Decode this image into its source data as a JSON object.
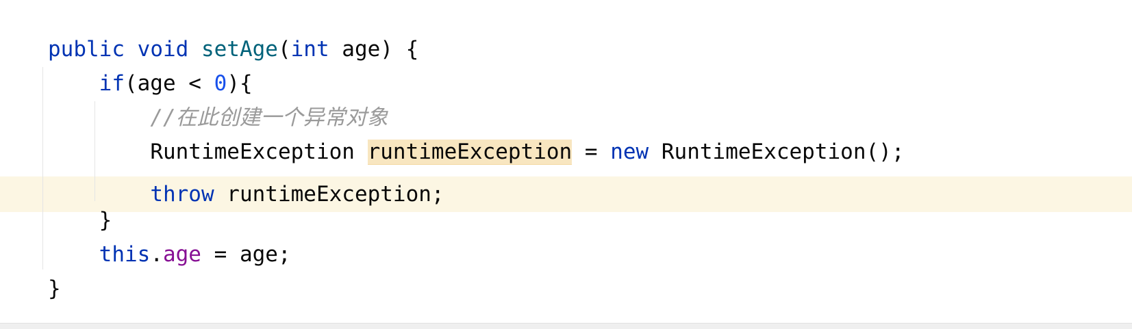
{
  "editor": {
    "lines": [
      {
        "indent": "",
        "tokens": [
          {
            "kind": "kw",
            "text": "public"
          },
          {
            "kind": "plain",
            "text": " "
          },
          {
            "kind": "kw",
            "text": "void"
          },
          {
            "kind": "plain",
            "text": " "
          },
          {
            "kind": "fn",
            "text": "setAge"
          },
          {
            "kind": "plain",
            "text": "("
          },
          {
            "kind": "kw",
            "text": "int"
          },
          {
            "kind": "plain",
            "text": " age) {"
          }
        ]
      },
      {
        "indent": "    ",
        "tokens": [
          {
            "kind": "kw",
            "text": "if"
          },
          {
            "kind": "plain",
            "text": "(age < "
          },
          {
            "kind": "num",
            "text": "0"
          },
          {
            "kind": "plain",
            "text": "){"
          }
        ]
      },
      {
        "indent": "        ",
        "tokens": [
          {
            "kind": "comment",
            "text": "//在此创建一个异常对象"
          }
        ]
      },
      {
        "indent": "        ",
        "tokens": [
          {
            "kind": "plain",
            "text": "RuntimeException "
          },
          {
            "kind": "highlight",
            "text": "runtimeException"
          },
          {
            "kind": "plain",
            "text": " = "
          },
          {
            "kind": "kw",
            "text": "new"
          },
          {
            "kind": "plain",
            "text": " RuntimeException();"
          }
        ]
      },
      {
        "indent": "        ",
        "tokens": [
          {
            "kind": "kw",
            "text": "throw"
          },
          {
            "kind": "plain",
            "text": " runtimeException;"
          }
        ]
      },
      {
        "indent": "    ",
        "tokens": [
          {
            "kind": "plain",
            "text": "}"
          }
        ]
      },
      {
        "indent": "    ",
        "tokens": [
          {
            "kind": "kw",
            "text": "this"
          },
          {
            "kind": "plain",
            "text": "."
          },
          {
            "kind": "field",
            "text": "age"
          },
          {
            "kind": "plain",
            "text": " = age;"
          }
        ]
      },
      {
        "indent": "",
        "tokens": [
          {
            "kind": "plain",
            "text": "}"
          }
        ]
      }
    ],
    "current_line_index": 4,
    "colors": {
      "keyword": "#0033b3",
      "method": "#00627a",
      "number": "#1750eb",
      "field": "#871094",
      "comment": "#9a9a9a",
      "current_line": "#fcf6e3",
      "identifier_highlight": "#f8e6c0"
    }
  }
}
